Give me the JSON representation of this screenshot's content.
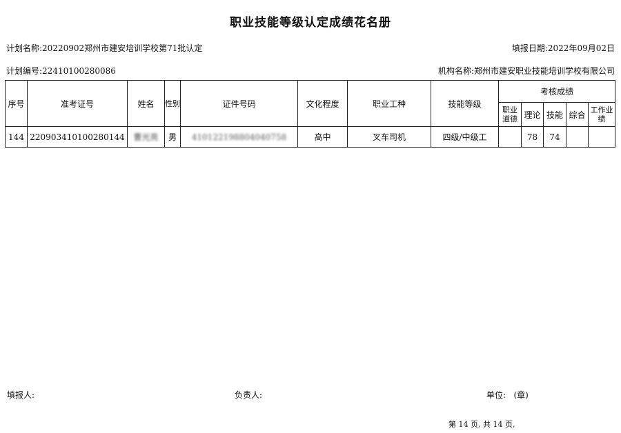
{
  "title": "职业技能等级认定成绩花名册",
  "plan_name_label": "计划名称:",
  "plan_name": "20220902郑州市建安培训学校第71批认定",
  "report_date_label": "填报日期:",
  "report_date": "2022年09月02日",
  "plan_no_label": "计划编号:",
  "plan_no": "22410100280086",
  "org_label": "机构名称:",
  "org_name": "郑州市建安职业技能培训学校有限公司",
  "table": {
    "headers": {
      "seq": "序号",
      "exam_no": "准考证号",
      "name": "姓名",
      "gender": "性别",
      "id_no": "证件号码",
      "education": "文化程度",
      "occupation": "职业工种",
      "skill_level": "技能等级",
      "scores_group": "考核成绩",
      "ethics": "职业道德",
      "theory": "理论",
      "skill": "技能",
      "comprehensive": "综合",
      "work_perf": "工作业绩"
    },
    "rows": [
      {
        "seq": "144",
        "exam_no": "220903410100280144",
        "name": "曹光亮",
        "gender": "男",
        "id_no": "410122198804040758",
        "education": "高中",
        "occupation": "叉车司机",
        "skill_level": "四级/中级工",
        "ethics": "",
        "theory": "78",
        "skill": "74",
        "comprehensive": "",
        "work_perf": ""
      }
    ]
  },
  "footer": {
    "filler_label": "填报人:",
    "responsible_label": "负责人:",
    "unit_label": "单位:",
    "seal": "(章)",
    "pager": "第 14 页, 共 14 页,"
  }
}
